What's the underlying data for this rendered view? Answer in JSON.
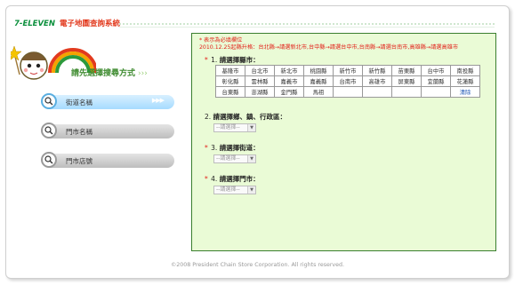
{
  "header": {
    "brand": "7-ELEVEN",
    "title": "電子地圖查詢系統"
  },
  "prompt": {
    "label": "請先選擇搜尋方式",
    "arrows": "›››"
  },
  "sidebar": {
    "items": [
      {
        "label": "街道名稱",
        "active": true,
        "chevrons": "▶▶▶"
      },
      {
        "label": "門市名稱",
        "active": false
      },
      {
        "label": "門市店號",
        "active": false
      }
    ]
  },
  "form": {
    "required_note": "* 表示為必填欄位",
    "notice": "2010.12.25起縣升格：台北縣→請選新北市,台中縣→請選台中市,台南縣→請選台南市,高雄縣→請選高雄市",
    "steps": [
      {
        "num": "1.",
        "label": "請選擇縣市：",
        "required": true
      },
      {
        "num": "2.",
        "label": "請選擇鄉、鎮、行政區：",
        "required": false
      },
      {
        "num": "3.",
        "label": "請選擇街道：",
        "required": true
      },
      {
        "num": "4.",
        "label": "請選擇門市：",
        "required": true
      }
    ],
    "select_placeholder": "--請選擇--",
    "cities": [
      [
        "基隆市",
        "台北市",
        "新北市",
        "桃園縣",
        "新竹市",
        "新竹縣",
        "苗栗縣",
        "台中市",
        "南投縣"
      ],
      [
        "彰化縣",
        "雲林縣",
        "嘉義市",
        "嘉義縣",
        "台南市",
        "高雄市",
        "屏東縣",
        "宜蘭縣",
        "花蓮縣"
      ],
      [
        "台東縣",
        "澎湖縣",
        "金門縣",
        "馬祖",
        "",
        "",
        "",
        "",
        "清除"
      ]
    ]
  },
  "footer": {
    "copyright": "©2008 President Chain Store Corporation. All rights reserved."
  },
  "colors": {
    "panel_bg": "#eafbd6",
    "panel_border": "#3a7f2e",
    "required_red": "#e3211a",
    "brand_green": "#0b8f3c",
    "active_blue": "#a6dbff"
  },
  "icons": [
    "magnifier-icon",
    "mascot-logo"
  ]
}
